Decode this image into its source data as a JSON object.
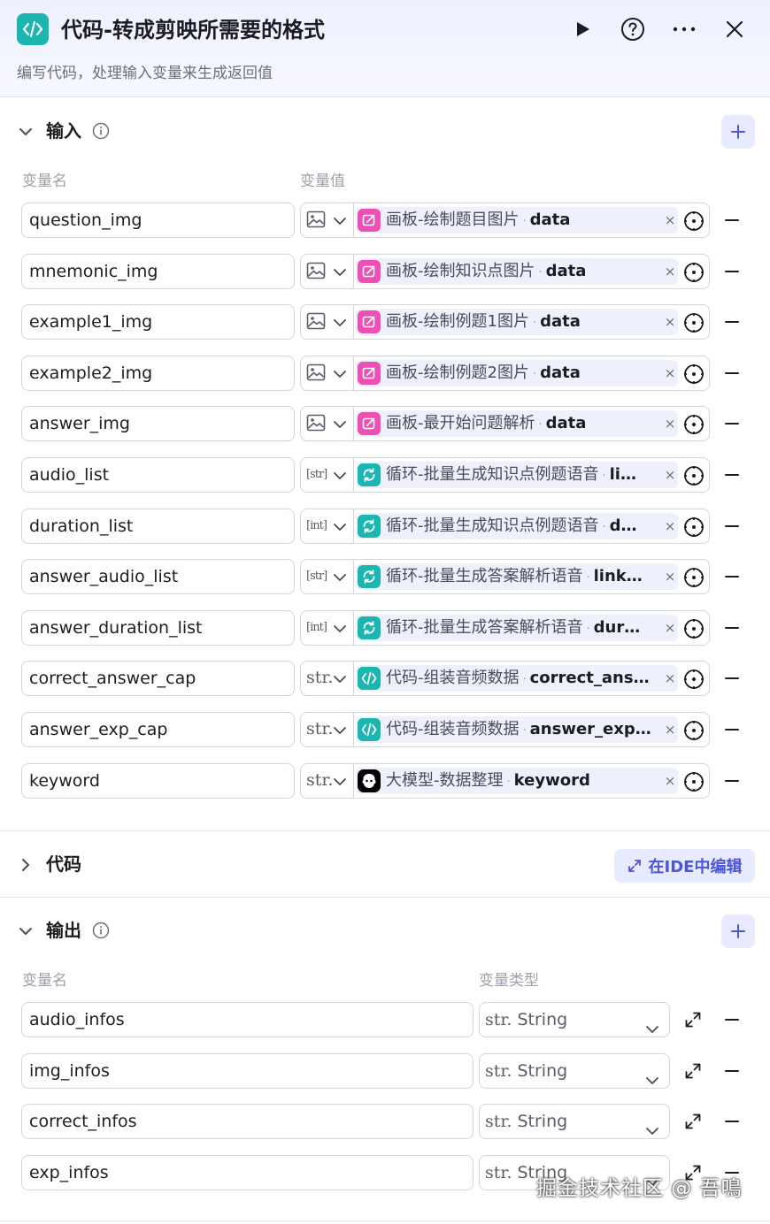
{
  "header": {
    "title": "代码-转成剪映所需要的格式",
    "subtitle": "编写代码，处理输入变量来生成返回值",
    "icons": [
      "code-icon",
      "play-icon",
      "help-icon",
      "more-icon",
      "close-icon"
    ]
  },
  "input": {
    "title": "输入",
    "col_name": "变量名",
    "col_value": "变量值",
    "rows": [
      {
        "name": "question_img",
        "type": "image",
        "type_label": "",
        "ref_color": "pink",
        "ref_node": "画板-绘制题目图片",
        "ref_sep": "·",
        "ref_field": "data"
      },
      {
        "name": "mnemonic_img",
        "type": "image",
        "type_label": "",
        "ref_color": "pink",
        "ref_node": "画板-绘制知识点图片",
        "ref_sep": "·",
        "ref_field": "data"
      },
      {
        "name": "example1_img",
        "type": "image",
        "type_label": "",
        "ref_color": "pink",
        "ref_node": "画板-绘制例题1图片",
        "ref_sep": "·",
        "ref_field": "data"
      },
      {
        "name": "example2_img",
        "type": "image",
        "type_label": "",
        "ref_color": "pink",
        "ref_node": "画板-绘制例题2图片",
        "ref_sep": "·",
        "ref_field": "data"
      },
      {
        "name": "answer_img",
        "type": "image",
        "type_label": "",
        "ref_color": "pink",
        "ref_node": "画板-最开始问题解析",
        "ref_sep": "·",
        "ref_field": "data"
      },
      {
        "name": "audio_list",
        "type": "array",
        "type_label": "[str]",
        "ref_color": "teal",
        "ref_node": "循环-批量生成知识点例题语音",
        "ref_sep": "·",
        "ref_field": "li…"
      },
      {
        "name": "duration_list",
        "type": "array",
        "type_label": "[int]",
        "ref_color": "teal",
        "ref_node": "循环-批量生成知识点例题语音",
        "ref_sep": "·",
        "ref_field": "d…"
      },
      {
        "name": "answer_audio_list",
        "type": "array",
        "type_label": "[str]",
        "ref_color": "teal",
        "ref_node": "循环-批量生成答案解析语音",
        "ref_sep": "·",
        "ref_field": "link…"
      },
      {
        "name": "answer_duration_list",
        "type": "array",
        "type_label": "[int]",
        "ref_color": "teal",
        "ref_node": "循环-批量生成答案解析语音",
        "ref_sep": "·",
        "ref_field": "dur…"
      },
      {
        "name": "correct_answer_cap",
        "type": "string",
        "type_label": "str.",
        "ref_color": "teal",
        "ref_node": "代码-组装音频数据",
        "ref_sep": "·",
        "ref_field": "correct_ans…"
      },
      {
        "name": "answer_exp_cap",
        "type": "string",
        "type_label": "str.",
        "ref_color": "teal",
        "ref_node": "代码-组装音频数据",
        "ref_sep": "·",
        "ref_field": "answer_exp…"
      },
      {
        "name": "keyword",
        "type": "string",
        "type_label": "str.",
        "ref_color": "black",
        "ref_node": "大模型-数据整理",
        "ref_sep": "·",
        "ref_field": "keyword"
      }
    ]
  },
  "code": {
    "title": "代码",
    "ide_button": "在IDE中编辑"
  },
  "output": {
    "title": "输出",
    "col_name": "变量名",
    "col_type": "变量类型",
    "rows": [
      {
        "name": "audio_infos",
        "type_glyph": "str.",
        "type_name": "String"
      },
      {
        "name": "img_infos",
        "type_glyph": "str.",
        "type_name": "String"
      },
      {
        "name": "correct_infos",
        "type_glyph": "str.",
        "type_name": "String"
      },
      {
        "name": "exp_infos",
        "type_glyph": "str.",
        "type_name": "String"
      }
    ]
  },
  "watermark": "掘金技术社区 @ 吾鳴",
  "colors": {
    "accent": "#4b56d8",
    "teal_node": "#1bb6b0",
    "pink_node": "#ee4fb4",
    "add_bg": "#e8ebff"
  }
}
